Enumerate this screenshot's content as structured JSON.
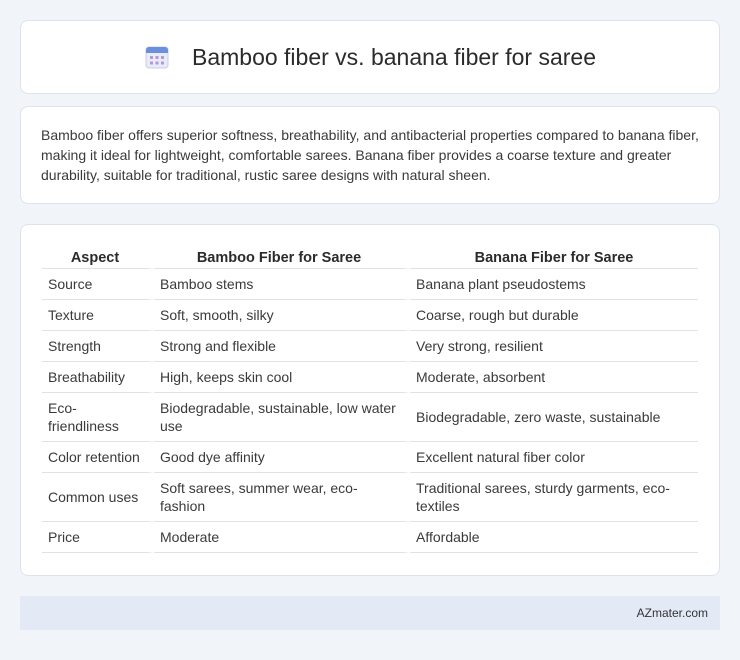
{
  "header": {
    "title": "Bamboo fiber vs. banana fiber for saree",
    "icon": "calendar-icon"
  },
  "summary": {
    "text": "Bamboo fiber offers superior softness, breathability, and antibacterial properties compared to banana fiber, making it ideal for lightweight, comfortable sarees. Banana fiber provides a coarse texture and greater durability, suitable for traditional, rustic saree designs with natural sheen."
  },
  "table": {
    "headers": [
      "Aspect",
      "Bamboo Fiber for Saree",
      "Banana Fiber for Saree"
    ],
    "rows": [
      [
        "Source",
        "Bamboo stems",
        "Banana plant pseudostems"
      ],
      [
        "Texture",
        "Soft, smooth, silky",
        "Coarse, rough but durable"
      ],
      [
        "Strength",
        "Strong and flexible",
        "Very strong, resilient"
      ],
      [
        "Breathability",
        "High, keeps skin cool",
        "Moderate, absorbent"
      ],
      [
        "Eco-friendliness",
        "Biodegradable, sustainable, low water use",
        "Biodegradable, zero waste, sustainable"
      ],
      [
        "Color retention",
        "Good dye affinity",
        "Excellent natural fiber color"
      ],
      [
        "Common uses",
        "Soft sarees, summer wear, eco-fashion",
        "Traditional sarees, sturdy garments, eco-textiles"
      ],
      [
        "Price",
        "Moderate",
        "Affordable"
      ]
    ]
  },
  "footer": {
    "brand": "AZmater.com"
  },
  "colors": {
    "background": "#f1f4f9",
    "card": "#ffffff",
    "footer": "#e4eaf5",
    "icon_accent": "#6a8fdc"
  }
}
